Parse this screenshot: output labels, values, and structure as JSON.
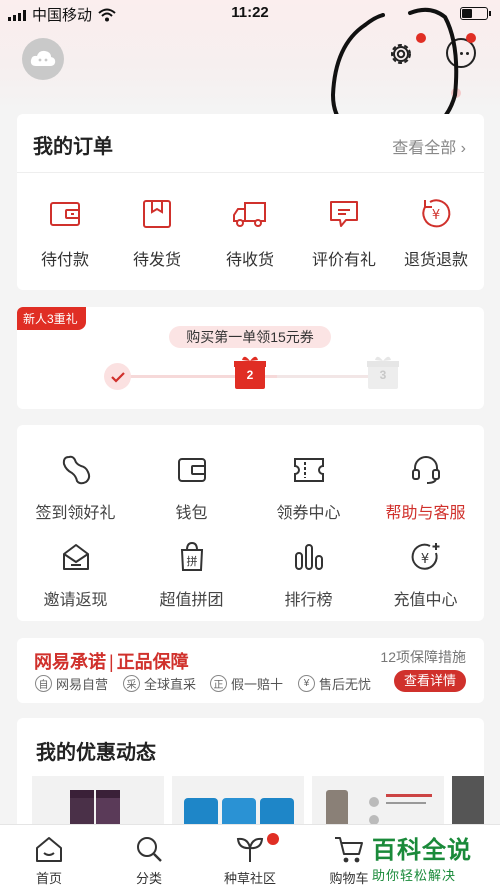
{
  "status_bar": {
    "carrier": "中国移动",
    "time": "11:22"
  },
  "orders": {
    "title": "我的订单",
    "see_all": "查看全部 ›",
    "items": [
      {
        "label": "待付款",
        "icon": "wallet-icon"
      },
      {
        "label": "待发货",
        "icon": "package-icon"
      },
      {
        "label": "待收货",
        "icon": "truck-icon"
      },
      {
        "label": "评价有礼",
        "icon": "review-icon"
      },
      {
        "label": "退货退款",
        "icon": "refund-icon"
      }
    ]
  },
  "new_user_gift": {
    "tag": "新人3重礼",
    "headline": "购买第一单领15元券",
    "step2": "2",
    "step3": "3"
  },
  "services": {
    "items": [
      {
        "label": "签到领好礼",
        "icon": "bean-icon"
      },
      {
        "label": "钱包",
        "icon": "wallet-icon"
      },
      {
        "label": "领券中心",
        "icon": "coupon-icon"
      },
      {
        "label": "帮助与客服",
        "icon": "headset-icon"
      },
      {
        "label": "邀请返现",
        "icon": "invite-icon"
      },
      {
        "label": "超值拼团",
        "icon": "group-buy-icon"
      },
      {
        "label": "排行榜",
        "icon": "ranking-icon"
      },
      {
        "label": "充值中心",
        "icon": "topup-icon"
      }
    ]
  },
  "guarantee": {
    "brand": "网易承诺",
    "promise": "正品保障",
    "measures": "12项保障措施",
    "features": [
      {
        "mark": "自",
        "label": "网易自营"
      },
      {
        "mark": "采",
        "label": "全球直采"
      },
      {
        "mark": "正",
        "label": "假一赔十"
      },
      {
        "mark": "¥",
        "label": "售后无忧"
      }
    ],
    "detail_button": "查看详情"
  },
  "deals": {
    "title": "我的优惠动态"
  },
  "tabbar": {
    "items": [
      {
        "label": "首页",
        "icon": "home-icon"
      },
      {
        "label": "分类",
        "icon": "search-icon"
      },
      {
        "label": "种草社区",
        "icon": "sprout-icon"
      },
      {
        "label": "购物车",
        "icon": "cart-icon"
      }
    ]
  },
  "watermark": {
    "title": "百科全说",
    "subtitle": "助你轻松解决"
  },
  "colors": {
    "accent": "#d0312c",
    "badge": "#e02e24"
  }
}
